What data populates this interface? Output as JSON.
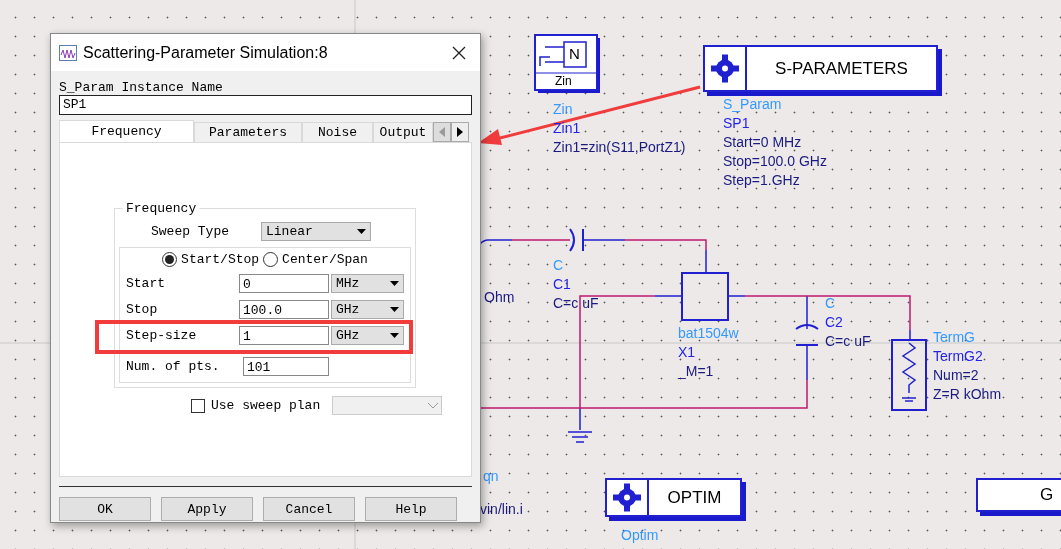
{
  "dialog": {
    "title": "Scattering-Parameter Simulation:8",
    "instance_label": "S_Param Instance Name",
    "instance_value": "SP1",
    "tabs": [
      {
        "label": "Frequency",
        "selected": true
      },
      {
        "label": "Parameters",
        "selected": false
      },
      {
        "label": "Noise",
        "selected": false
      },
      {
        "label": "Output",
        "selected": false
      }
    ],
    "frequency_group": {
      "title": "Frequency",
      "sweep_type_label": "Sweep Type",
      "sweep_type": "Linear",
      "modes": [
        {
          "label": "Start/Stop",
          "selected": true
        },
        {
          "label": "Center/Span",
          "selected": false
        }
      ],
      "fields": [
        {
          "label": "Start",
          "value": "0",
          "unit": "MHz"
        },
        {
          "label": "Stop",
          "value": "100.0",
          "unit": "GHz"
        },
        {
          "label": "Step-size",
          "value": "1",
          "unit": "GHz"
        },
        {
          "label": "Num. of pts.",
          "value": "101"
        }
      ],
      "sweep_plan": {
        "label": "Use sweep plan",
        "checked": false
      }
    },
    "buttons": [
      "OK",
      "Apply",
      "Cancel",
      "Help"
    ]
  },
  "schematic": {
    "components": [
      {
        "kind": "zin",
        "port_letter": "N",
        "caption": "Zin",
        "labels": [
          {
            "text": "Zin",
            "color": "#3399ff"
          },
          {
            "text": "Zin1",
            "color": "#2323e8"
          },
          {
            "text": "Zin1=zin(S11,PortZ1)",
            "color": "#1a1a80"
          }
        ]
      },
      {
        "kind": "controller",
        "caption": "S-PARAMETERS",
        "labels": [
          {
            "text": "S_Param",
            "color": "#3399ff"
          },
          {
            "text": "SP1",
            "color": "#2323e8"
          },
          {
            "text": "Start=0 MHz",
            "color": "#1a1a80"
          },
          {
            "text": "Stop=100.0 GHz",
            "color": "#1a1a80"
          },
          {
            "text": "Step=1.GHz",
            "color": "#1a1a80"
          }
        ]
      },
      {
        "kind": "text",
        "labels": [
          {
            "text": "Ohm",
            "color": "#1a1a80"
          }
        ]
      },
      {
        "kind": "capacitor",
        "labels": [
          {
            "text": "C",
            "color": "#3399ff"
          },
          {
            "text": "C1",
            "color": "#2323e8"
          },
          {
            "text": "C=c uF",
            "color": "#1a1a80"
          }
        ]
      },
      {
        "kind": "device",
        "labels": [
          {
            "text": "bat1504w",
            "color": "#3399ff"
          },
          {
            "text": "X1",
            "color": "#2323e8"
          },
          {
            "text": "_M=1",
            "color": "#1a1a80"
          }
        ]
      },
      {
        "kind": "capacitor",
        "labels": [
          {
            "text": "C",
            "color": "#3399ff"
          },
          {
            "text": "C2",
            "color": "#2323e8"
          },
          {
            "text": "C=c uF",
            "color": "#1a1a80"
          }
        ]
      },
      {
        "kind": "term",
        "labels": [
          {
            "text": "TermG",
            "color": "#3399ff"
          },
          {
            "text": "TermG2",
            "color": "#2323e8"
          },
          {
            "text": "Num=2",
            "color": "#1a1a80"
          },
          {
            "text": "Z=R kOhm",
            "color": "#1a1a80"
          }
        ]
      },
      {
        "kind": "text",
        "labels": [
          {
            "text": "qn",
            "color": "#3399ff"
          }
        ]
      },
      {
        "kind": "text",
        "labels": [
          {
            "text": "vin/lin.i",
            "color": "#1a1a80"
          }
        ]
      },
      {
        "kind": "controller",
        "caption": "OPTIM",
        "labels": [
          {
            "text": "Optim",
            "color": "#3399ff"
          }
        ]
      },
      {
        "kind": "partial",
        "caption": "G"
      }
    ]
  }
}
